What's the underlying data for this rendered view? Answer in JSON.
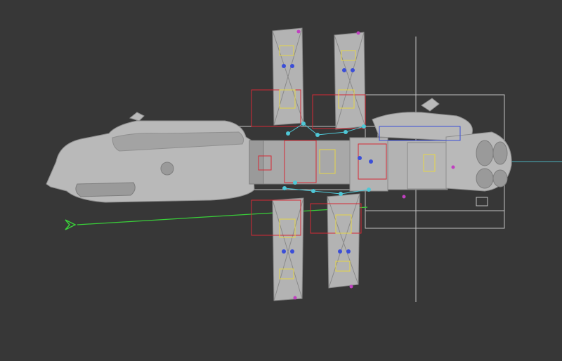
{
  "viewport": {
    "background_color": "#373737",
    "colors": {
      "hull": "#b9b9b9",
      "wire_white": "#d8d8d8",
      "wire_red": "#d42a36",
      "wire_yellow": "#e6d64a",
      "wire_cyan": "#4fc7d6",
      "wire_blue": "#3b4ed8",
      "wire_magenta": "#c040c0",
      "camera_green": "#39d039"
    },
    "icons": {
      "camera": "camera-frustum-icon"
    }
  }
}
